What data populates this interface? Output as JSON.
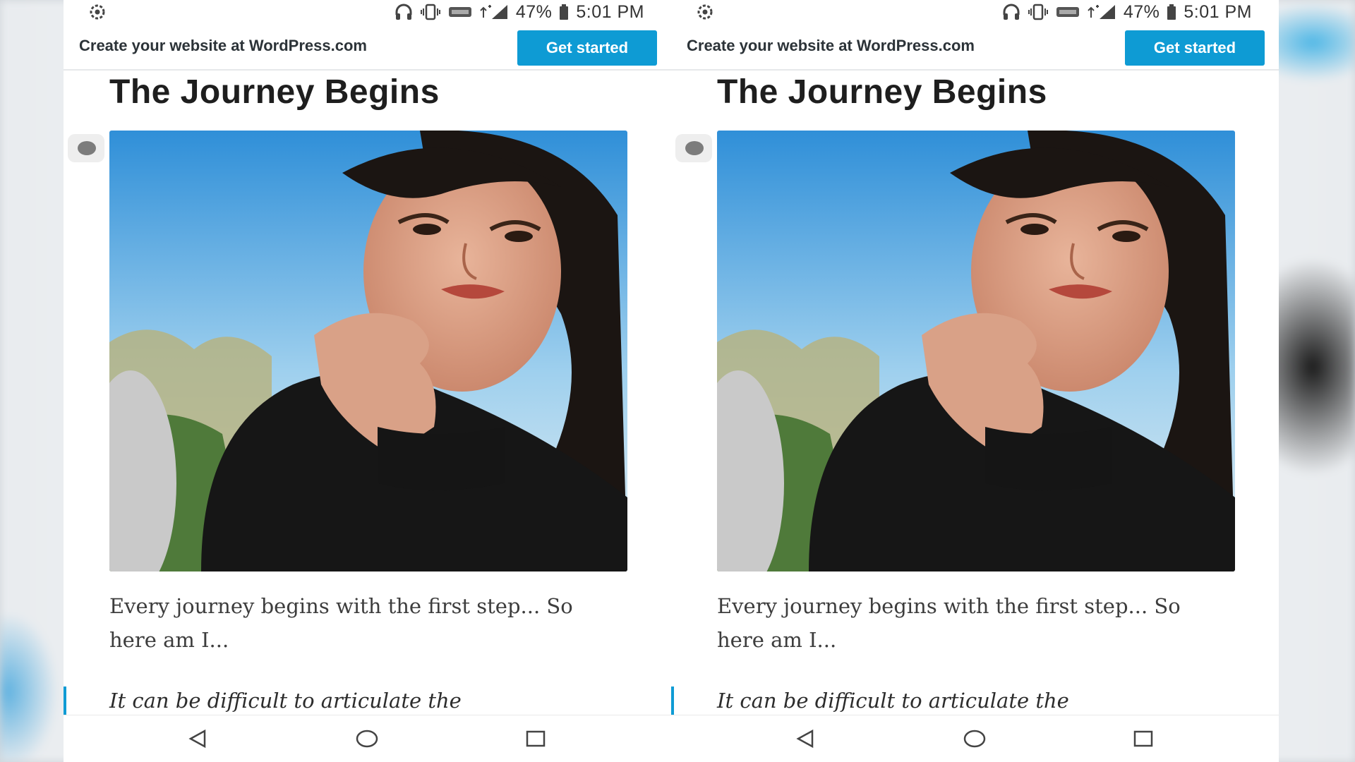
{
  "status_bar": {
    "time": "5:01 PM",
    "battery": "47%",
    "icons": [
      "settings-icon",
      "headphones-icon",
      "vibrate-icon",
      "volte-icon",
      "signal-icon",
      "battery-icon"
    ]
  },
  "banner": {
    "text": "Create your website at WordPress.com",
    "button_label": "Get started",
    "button_color": "#0e9bd4"
  },
  "post": {
    "title": "The Journey Begins",
    "paragraph": "Every journey begins with the first step... So here am I...",
    "quote": "It can be difficult to articulate the"
  },
  "nav_bar": {
    "icons": [
      "back-icon",
      "home-icon",
      "recents-icon"
    ]
  }
}
